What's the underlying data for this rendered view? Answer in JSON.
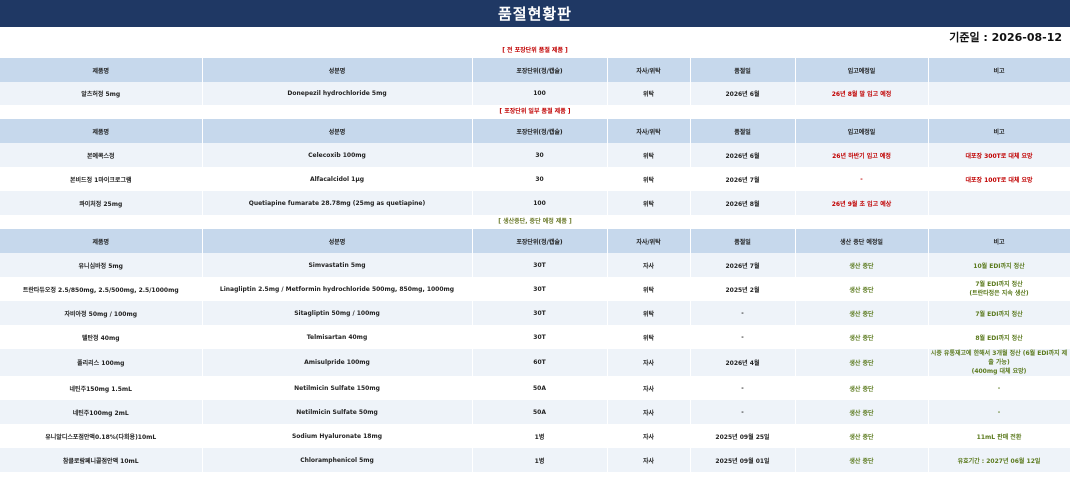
{
  "page": {
    "title": "품절현황판",
    "date_label": "기준일 : 2026-08-12"
  },
  "sections": [
    {
      "title": "[ 전 포장단위 품절 제품 ]",
      "headers": [
        "제품명",
        "성분명",
        "포장단위(정/캡슐)",
        "자사/위탁",
        "품절일",
        "입고예정일",
        "비고"
      ],
      "rows": [
        [
          "알츠허정 5mg",
          "Donepezil hydrochloride 5mg",
          "100",
          "위탁",
          "2026년 6월",
          "26년 8월 말 입고 예정",
          ""
        ]
      ]
    },
    {
      "title": "[ 포장단위 일부 품절 제품 ]",
      "headers": [
        "제품명",
        "성분명",
        "포장단위(정/캡슐)",
        "자사/위탁",
        "품절일",
        "입고예정일",
        "비고"
      ],
      "rows": [
        [
          "본예콕스정",
          "Celecoxib 100mg",
          "30",
          "위탁",
          "2026년 6월",
          "26년 하반기 입고 예정",
          "대포장 300T로 대체 요망"
        ],
        [
          "본비드정 1마이크로그램",
          "Alfacalcidol 1μg",
          "30",
          "위탁",
          "2026년 7월",
          "-",
          "대포장 100T로 대체 요망"
        ],
        [
          "콰이처정 25mg",
          "Quetiapine fumarate 28.78mg (25mg as quetiapine)",
          "100",
          "위탁",
          "2026년 8월",
          "26년 9월 초 입고 예상",
          ""
        ]
      ]
    },
    {
      "title": "[ 생산중단, 중단 예정 제품 ]",
      "headers": [
        "제품명",
        "성분명",
        "포장단위(정/캡슐)",
        "자사/위탁",
        "품절일",
        "생산 중단 예정일",
        "비고"
      ],
      "rows": [
        [
          "유니심바정 5mg",
          "Simvastatin 5mg",
          "30T",
          "자사",
          "2026년 7월",
          "생산 중단",
          "10월 EDI까지 정산"
        ],
        [
          "트란타듀오정 2.5/850mg, 2.5/500mg, 2.5/1000mg",
          "Linagliptin 2.5mg / Metformin hydrochloride 500mg, 850mg, 1000mg",
          "30T",
          "위탁",
          "2025년 2월",
          "생산 중단",
          "7월 EDI까지 정산|(트란타정은 지속 생산)"
        ],
        [
          "자비아정 50mg / 100mg",
          "Sitagliptin 50mg / 100mg",
          "30T",
          "위탁",
          "-",
          "생산 중단",
          "7월 EDI까지 정산"
        ],
        [
          "텔탄정 40mg",
          "Telmisartan 40mg",
          "30T",
          "위탁",
          "-",
          "생산 중단",
          "8월 EDI까지 정산"
        ],
        [
          "폴리리스 100mg",
          "Amisulpride 100mg",
          "60T",
          "자사",
          "2026년 4월",
          "생산 중단",
          "시중 유통재고에 한해서 3개월 정산 (6월 EDI까지 제출 가능)|(400mg 대체 요망)"
        ],
        [
          "네틴주150mg 1.5mL",
          "Netilmicin Sulfate 150mg",
          "50A",
          "자사",
          "-",
          "생산 중단",
          "-"
        ],
        [
          "네틴주100mg 2mL",
          "Netilmicin Sulfate 50mg",
          "50A",
          "자사",
          "-",
          "생산 중단",
          "-"
        ],
        [
          "유니알디스포점안액0.18%(다회용)10mL",
          "Sodium Hyaluronate 18mg",
          "1병",
          "자사",
          "2025년 09월 25일",
          "생산 중단",
          "11mL 판매 전환"
        ],
        [
          "참클로람페니콜점안액 10mL",
          "Chloramphenicol 5mg",
          "1병",
          "자사",
          "2025년 09월 01일",
          "생산 중단",
          "유효기간 : 2027년 06월 12일"
        ]
      ]
    }
  ],
  "colors": {
    "title_bar": "#1f3864",
    "header_bg": "#c6d8ec",
    "stripe_bg": "#eef3f9",
    "red": "#c00000",
    "green": "#5b7a1e"
  }
}
